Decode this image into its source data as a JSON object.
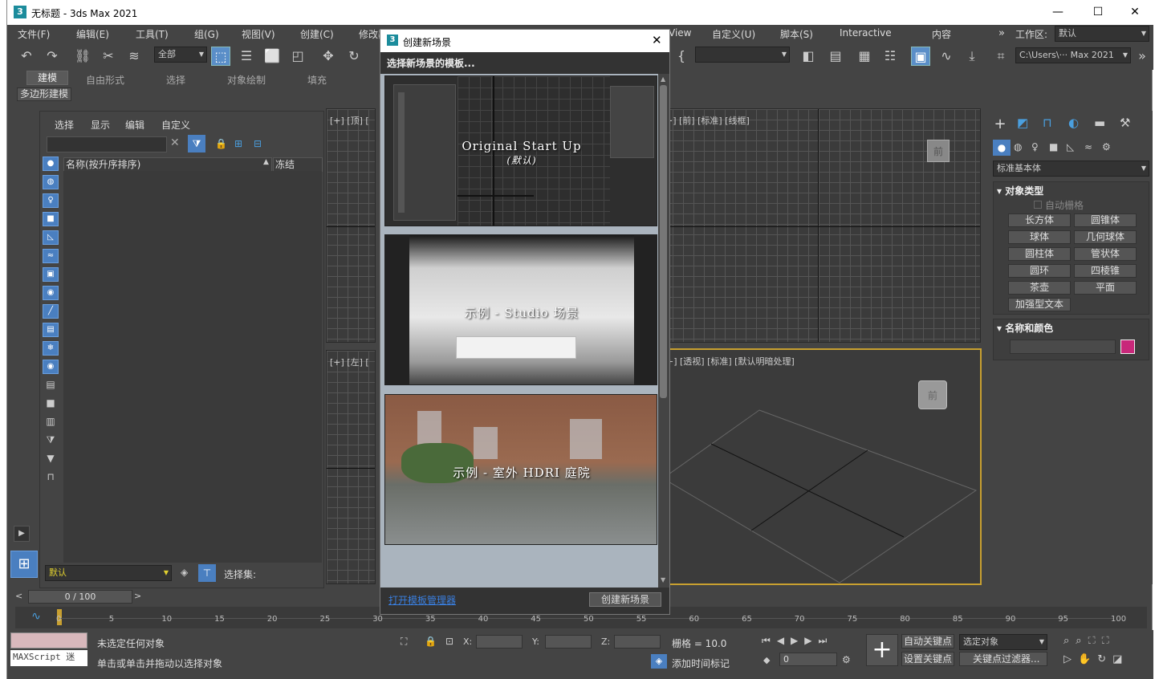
{
  "window": {
    "title": "无标题 - 3ds Max 2021",
    "app_icon": "3",
    "minimize": "—",
    "maximize": "☐",
    "close": "✕"
  },
  "menu": [
    "文件(F)",
    "编辑(E)",
    "工具(T)",
    "组(G)",
    "视图(V)",
    "创建(C)",
    "修改器",
    "View",
    "自定义(U)",
    "脚本(S)",
    "Interactive",
    "内容"
  ],
  "workspace": {
    "label": "工作区:",
    "value": "默认"
  },
  "toolbar": {
    "selection_filter": "全部",
    "path": "C:\\Users\\··· Max 2021"
  },
  "ribbon": {
    "tabs": [
      "建模",
      "自由形式",
      "选择",
      "对象绘制",
      "填充"
    ],
    "subtab": "多边形建模"
  },
  "scene_explorer": {
    "tabs": [
      "选择",
      "显示",
      "编辑",
      "自定义"
    ],
    "col_name": "名称(按升序排序)",
    "col_freeze": "冻结",
    "layer": "默认",
    "selection_set": "选择集:"
  },
  "viewports": {
    "top": "[+] [顶] [",
    "front": "+] [前] [标准] [线框]",
    "left": "[+] [左] [",
    "persp": "+] [透视] [标准] [默认明暗处理]"
  },
  "cmd": {
    "dropdown": "标准基本体",
    "section1": "对象类型",
    "autogrid": "自动栅格",
    "buttons": [
      "长方体",
      "圆锥体",
      "球体",
      "几何球体",
      "圆柱体",
      "管状体",
      "圆环",
      "四棱锥",
      "茶壶",
      "平面",
      "加强型文本"
    ],
    "section2": "名称和颜色",
    "accent": "#c8287a"
  },
  "dialog": {
    "title": "创建新场景",
    "subtitle": "选择新场景的模板...",
    "templates": [
      {
        "name": "Original Start Up",
        "sub": "(默认)"
      },
      {
        "name": "示例 - Studio 场景"
      },
      {
        "name": "示例 - 室外 HDRI 庭院"
      }
    ],
    "link": "打开模板管理器",
    "create": "创建新场景"
  },
  "time": {
    "frame": "0 / 100",
    "ticks": [
      "0",
      "5",
      "10",
      "15",
      "20",
      "25",
      "30",
      "35",
      "40",
      "45",
      "50",
      "55",
      "60",
      "65",
      "70",
      "75",
      "80",
      "85",
      "90",
      "95",
      "100"
    ]
  },
  "status": {
    "msg1": "未选定任何对象",
    "msg2": "单击或单击并拖动以选择对象",
    "maxscript": "MAXScript 迷",
    "x": "X:",
    "y": "Y:",
    "z": "Z:",
    "grid": "栅格 = 10.0",
    "addtime": "添加时间标记",
    "autokey": "自动关键点",
    "setkey": "设置关键点",
    "selobj": "选定对象",
    "keyfilter": "关键点过滤器...",
    "frame": "0"
  }
}
